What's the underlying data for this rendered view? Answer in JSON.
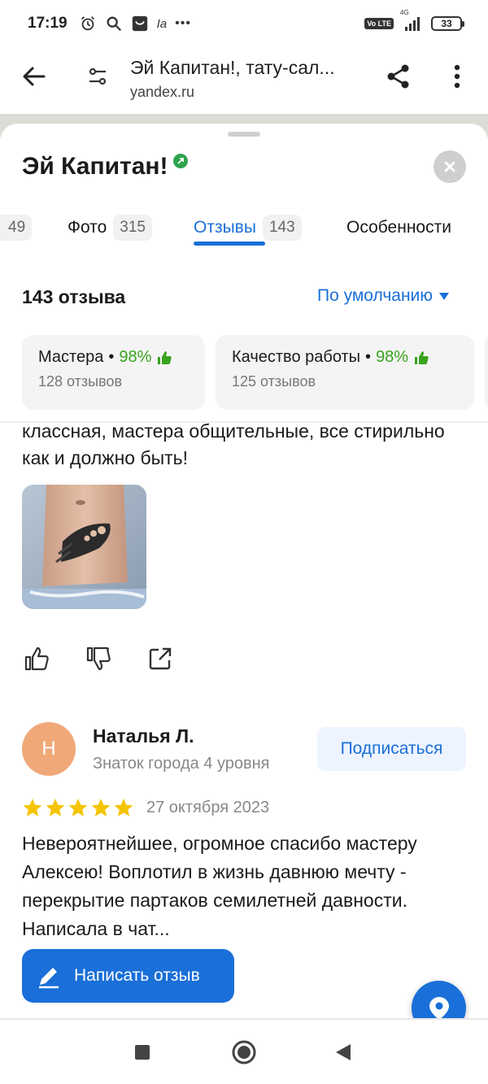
{
  "status_bar": {
    "time": "17:19",
    "icons": [
      "alarm-icon",
      "search-icon",
      "notification-icon",
      "ia-icon",
      "more-dots-icon"
    ],
    "ia_text": "Ia",
    "dots_text": "•••",
    "network": "4G",
    "volte": "Vo LTE",
    "battery": "33"
  },
  "browser": {
    "title": "Эй Капитан!, тату-сал...",
    "url": "yandex.ru"
  },
  "org": {
    "title": "Эй Капитан!"
  },
  "tabs": [
    {
      "label": "",
      "count": "49"
    },
    {
      "label": "Фото",
      "count": "315"
    },
    {
      "label": "Отзывы",
      "count": "143",
      "active": true
    },
    {
      "label": "Особенности",
      "count": ""
    }
  ],
  "reviews": {
    "count_label": "143 отзыва",
    "sort_label": "По умолчанию"
  },
  "aspects": [
    {
      "name": "Мастера",
      "dot": "•",
      "percent": "98%",
      "sub": "128 отзывов"
    },
    {
      "name": "Качество работы",
      "dot": "•",
      "percent": "98%",
      "sub": "125 отзывов"
    }
  ],
  "review_prev": {
    "text": "классная, мастера общительные, все стирильно как и должно быть!"
  },
  "review_next": {
    "avatar_letter": "Н",
    "author": "Наталья Л.",
    "level": "Знаток города 4 уровня",
    "subscribe_label": "Подписаться",
    "rating": 5,
    "date": "27 октября 2023",
    "text": "Невероятнейшее, огромное спасибо мастеру Алексею! Воплотил в жизнь давнюю мечту - перекрытие партаков семилетней давности. Написала в чат..."
  },
  "write_review_label": "Написать отзыв",
  "colors": {
    "accent": "#1a6fd8",
    "positive": "#3aa31f",
    "star": "#f5c400",
    "avatar": "#f0a878"
  }
}
